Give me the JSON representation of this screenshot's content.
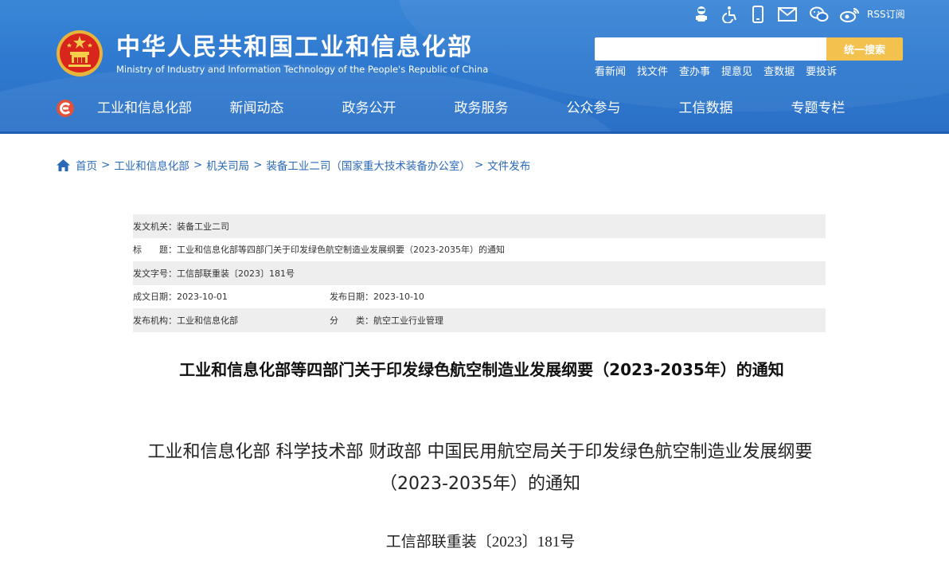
{
  "header": {
    "site_title": "中华人民共和国工业和信息化部",
    "site_subtitle": "Ministry of Industry and Information Technology of the People's Republic of China",
    "utility_icons": [
      "robot-icon",
      "accessibility-icon",
      "mobile-icon",
      "mail-icon",
      "wechat-icon",
      "weibo-icon"
    ],
    "rss_label": "RSS订阅",
    "search": {
      "placeholder": "",
      "value": "",
      "button_label": "统一搜索"
    },
    "quick_links": [
      "看新闻",
      "找文件",
      "查办事",
      "提意见",
      "查数据",
      "要投诉"
    ],
    "accent_color": "#f2c14e",
    "background_color": "#2f7ad0"
  },
  "nav": {
    "items": [
      "工业和信息化部",
      "新闻动态",
      "政务公开",
      "政务服务",
      "公众参与",
      "工信数据",
      "专题专栏"
    ]
  },
  "breadcrumb": {
    "items": [
      "首页",
      "工业和信息化部",
      "机关司局",
      "装备工业二司（国家重大技术装备办公室）",
      "文件发布"
    ],
    "separator": ">"
  },
  "meta": {
    "issuer": {
      "label": "发文机关：",
      "value": "装备工业二司"
    },
    "title": {
      "label": "标　　题：",
      "value": "工业和信息化部等四部门关于印发绿色航空制造业发展纲要（2023-2035年）的通知"
    },
    "doc_no": {
      "label": "发文字号：",
      "value": "工信部联重装〔2023〕181号"
    },
    "written_date": {
      "label": "成文日期：",
      "value": "2023-10-01"
    },
    "publish_date": {
      "label": "发布日期：",
      "value": "2023-10-10"
    },
    "org": {
      "label": "发布机构：",
      "value": "工业和信息化部"
    },
    "category": {
      "label": "分　　类：",
      "value": "航空工业行业管理"
    }
  },
  "article": {
    "main_title": "工业和信息化部等四部门关于印发绿色航空制造业发展纲要（2023-2035年）的通知",
    "doc_title": "工业和信息化部 科学技术部 财政部 中国民用航空局关于印发绿色航空制造业发展纲要（2023-2035年）的通知",
    "doc_number": "工信部联重装〔2023〕181号"
  }
}
